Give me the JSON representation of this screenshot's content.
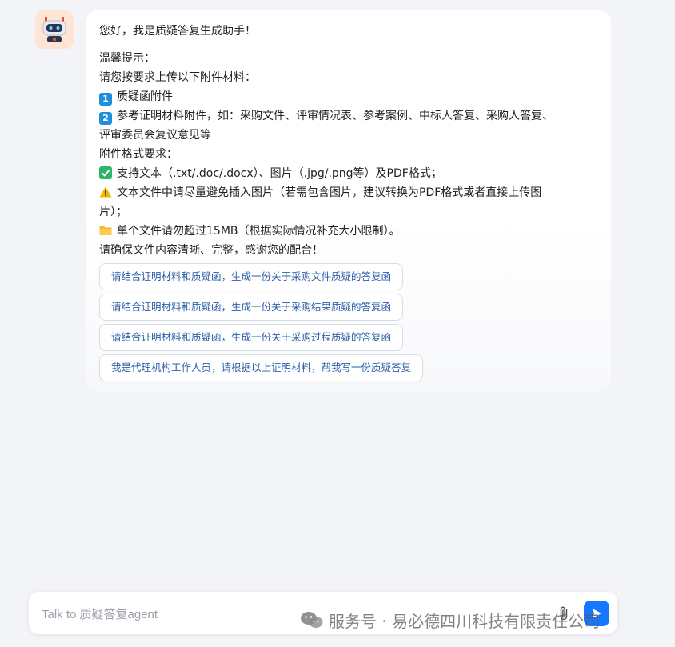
{
  "message": {
    "greeting": "您好，我是质疑答复生成助手！",
    "tip_title": "温馨提示：",
    "upload_intro": "请您按要求上传以下附件材料：",
    "item1_num": "1",
    "item1": "质疑函附件",
    "item2_num": "2",
    "item2_line1": "参考证明材料附件，如：采购文件、评审情况表、参考案例、中标人答复、采购人答复、",
    "item2_line2": "评审委员会复议意见等",
    "format_title": "附件格式要求：",
    "fmt1": "支持文本（.txt/.doc/.docx）、图片（.jpg/.png等）及PDF格式；",
    "fmt2_line1": "文本文件中请尽量避免插入图片（若需包含图片，建议转换为PDF格式或者直接上传图",
    "fmt2_line2": "片）；",
    "fmt3": "单个文件请勿超过15MB（根据实际情况补充大小限制）。",
    "closing": "请确保文件内容清晰、完整，感谢您的配合！"
  },
  "suggestions": [
    "请结合证明材料和质疑函，生成一份关于采购文件质疑的答复函",
    "请结合证明材料和质疑函，生成一份关于采购结果质疑的答复函",
    "请结合证明材料和质疑函，生成一份关于采购过程质疑的答复函",
    "我是代理机构工作人员，请根据以上证明材料，帮我写一份质疑答复"
  ],
  "input": {
    "placeholder": "Talk to 质疑答复agent",
    "value": ""
  },
  "watermark": "服务号 · 易必德四川科技有限责任公司",
  "colors": {
    "accent": "#1677ff",
    "badge": "#1e8fe0",
    "link": "#2c5ea8",
    "check": "#2fb56a",
    "warning": "#f5b800",
    "folder": "#f5b630"
  }
}
